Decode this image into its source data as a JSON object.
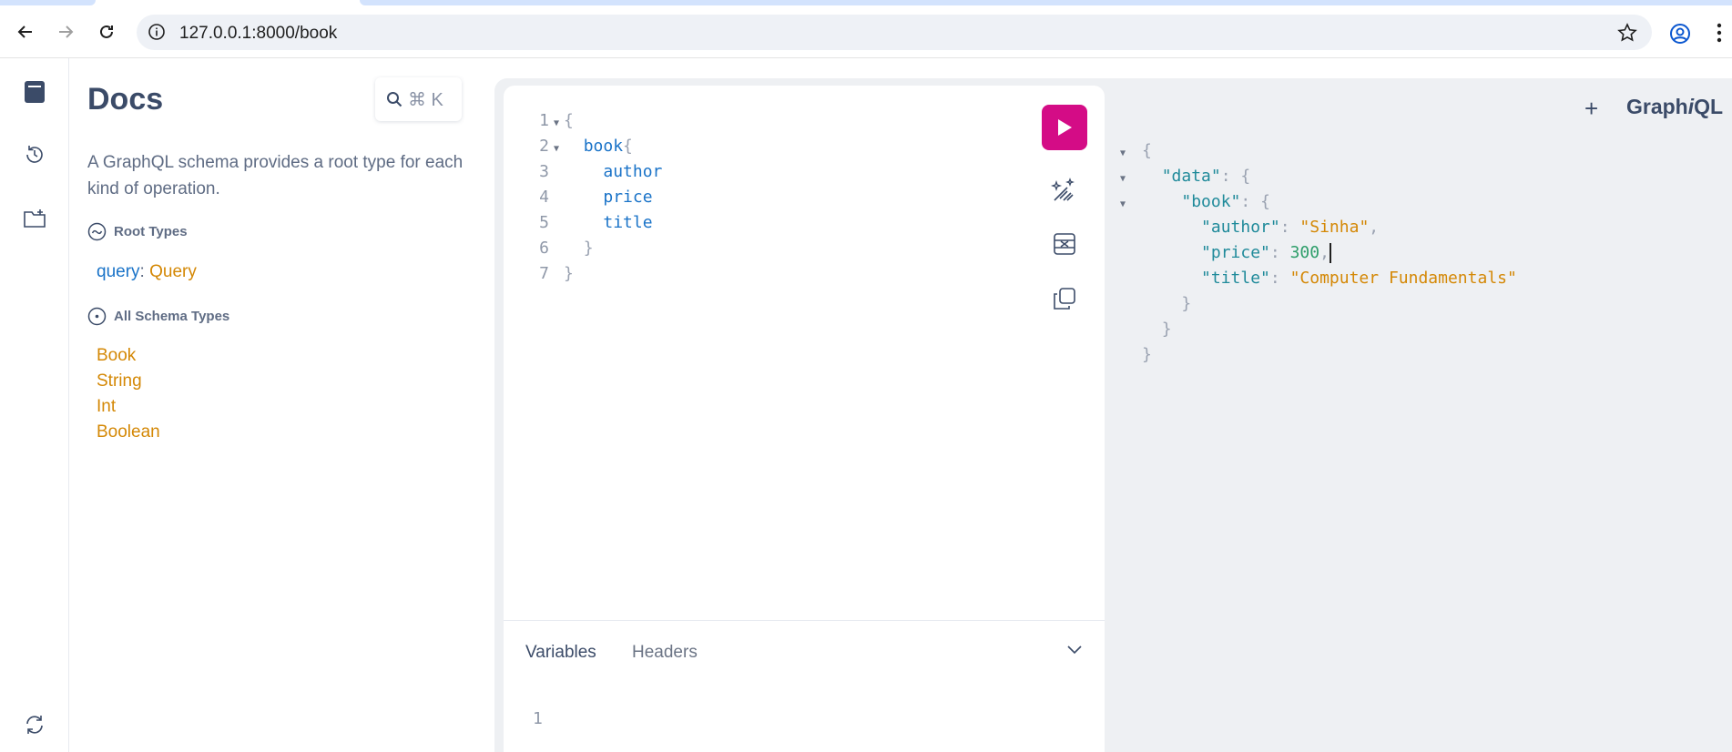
{
  "browser": {
    "url": "127.0.0.1:8000/book"
  },
  "docs": {
    "title": "Docs",
    "search_shortcut": "⌘ K",
    "description": "A GraphQL schema provides a root type for each kind of operation.",
    "root_types_heading": "Root Types",
    "root_query_field": "query",
    "root_query_type": "Query",
    "all_types_heading": "All Schema Types",
    "types": [
      "Book",
      "String",
      "Int",
      "Boolean"
    ]
  },
  "query_editor": {
    "line_numbers": [
      "1",
      "2",
      "3",
      "4",
      "5",
      "6",
      "7"
    ],
    "lines": [
      {
        "indent": "",
        "text": "{"
      },
      {
        "indent": "",
        "text": "book"
      },
      {
        "indent": "",
        "text": "author"
      },
      {
        "indent": "",
        "text": "price"
      },
      {
        "indent": "",
        "text": "title"
      },
      {
        "indent": "",
        "text": "}"
      },
      {
        "indent": "",
        "text": "}"
      }
    ],
    "brace_open": "{",
    "brace_close": "}",
    "field_book": "book",
    "field_author": "author",
    "field_price": "price",
    "field_title": "title"
  },
  "bottom_panel": {
    "variables_tab": "Variables",
    "headers_tab": "Headers",
    "line_number": "1"
  },
  "result": {
    "open": "{",
    "data_key": "\"data\"",
    "book_key": "\"book\"",
    "author_key": "\"author\"",
    "author_value": "\"Sinha\"",
    "price_key": "\"price\"",
    "price_value": "300",
    "title_key": "\"title\"",
    "title_value": "\"Computer Fundamentals\"",
    "close": "}"
  },
  "header_right": {
    "plus": "+",
    "logo_prefix": "Graph",
    "logo_italic": "i",
    "logo_suffix": "QL"
  },
  "colors": {
    "run_button": "#d40c86",
    "field": "#1a73c8",
    "type": "#d48806",
    "number": "#2e9e6a"
  }
}
